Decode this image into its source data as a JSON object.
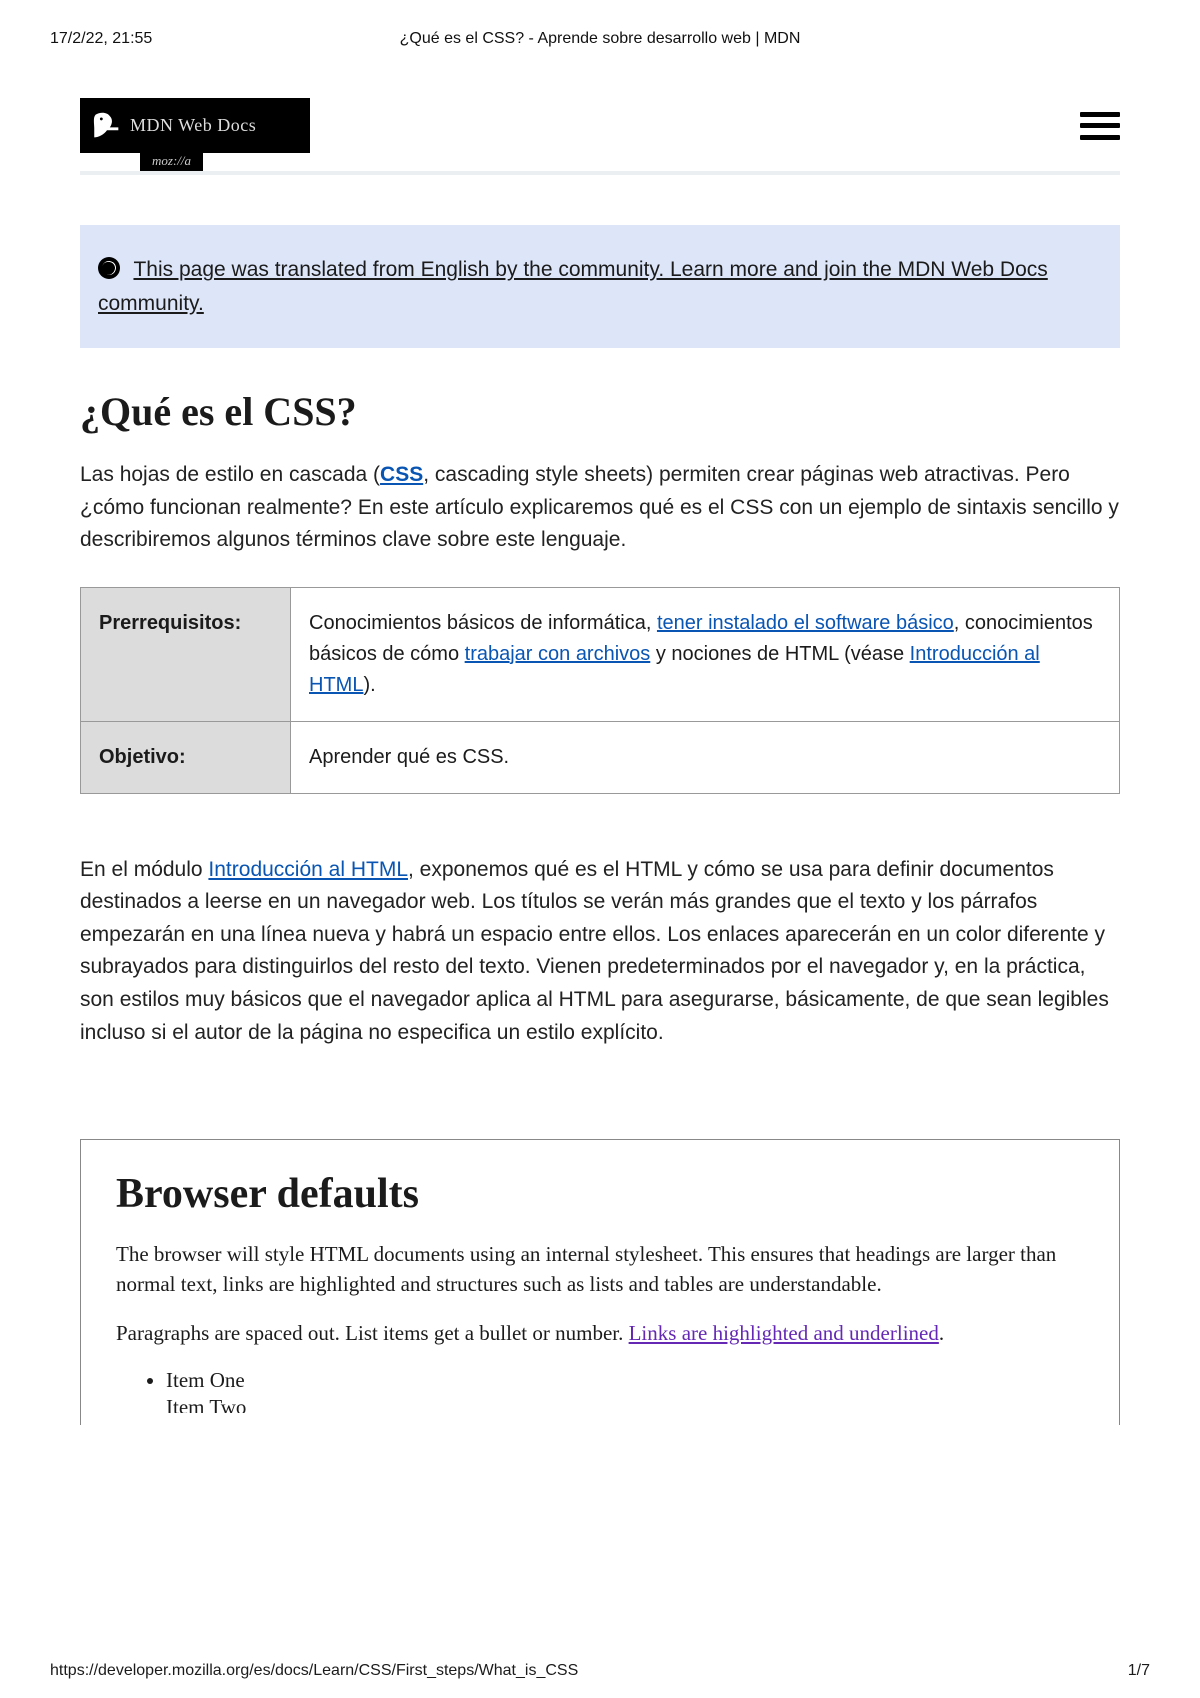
{
  "print": {
    "datetime": "17/2/22, 21:55",
    "title": "¿Qué es el CSS? - Aprende sobre desarrollo web | MDN",
    "url": "https://developer.mozilla.org/es/docs/Learn/CSS/First_steps/What_is_CSS",
    "page": "1/7"
  },
  "logo": {
    "main": "MDN Web Docs",
    "sub": "moz://a"
  },
  "banner": {
    "link_text": "This page was translated from English by the community. Learn more and join the MDN Web Docs community."
  },
  "heading": "¿Qué es el CSS?",
  "intro": {
    "pre": "Las hojas de estilo en cascada (",
    "css_link": "CSS",
    "post": ", cascading style sheets) permiten crear páginas web atractivas. Pero ¿cómo funcionan realmente? En este artículo explicaremos qué es el CSS con un ejemplo de sintaxis sencillo y describiremos algunos términos clave sobre este lenguaje."
  },
  "table": {
    "row1_label": "Prerrequisitos:",
    "row1": {
      "t1": "Conocimientos básicos de informática, ",
      "l1": "tener instalado el software básico",
      "t2": ", conocimientos básicos de cómo ",
      "l2": "trabajar con archivos",
      "t3": " y nociones de HTML (véase ",
      "l3": "Introducción al HTML",
      "t4": ")."
    },
    "row2_label": "Objetivo:",
    "row2_value": "Aprender qué es CSS."
  },
  "para2": {
    "t1": "En el módulo ",
    "l1": "Introducción al HTML",
    "t2": ", exponemos qué es el HTML y cómo se usa para definir documentos destinados a leerse en un navegador web. Los títulos se verán más grandes que el texto y los párrafos empezarán en una línea nueva y habrá un espacio entre ellos. Los enlaces aparecerán en un color diferente y subrayados para distinguirlos del resto del texto. Vienen predeterminados por el navegador y, en la práctica, son estilos muy básicos que el navegador aplica al HTML para asegurarse, básicamente, de que sean legibles incluso si el autor de la página no especifica un estilo explícito."
  },
  "example": {
    "heading": "Browser defaults",
    "p1": "The browser will style HTML documents using an internal stylesheet. This ensures that headings are larger than normal text, links are highlighted and structures such as lists and tables are understandable.",
    "p2_pre": "Paragraphs are spaced out. List items get a bullet or number. ",
    "p2_link": "Links are highlighted and underlined",
    "p2_post": ".",
    "items": [
      "Item One",
      "Item Two"
    ]
  }
}
